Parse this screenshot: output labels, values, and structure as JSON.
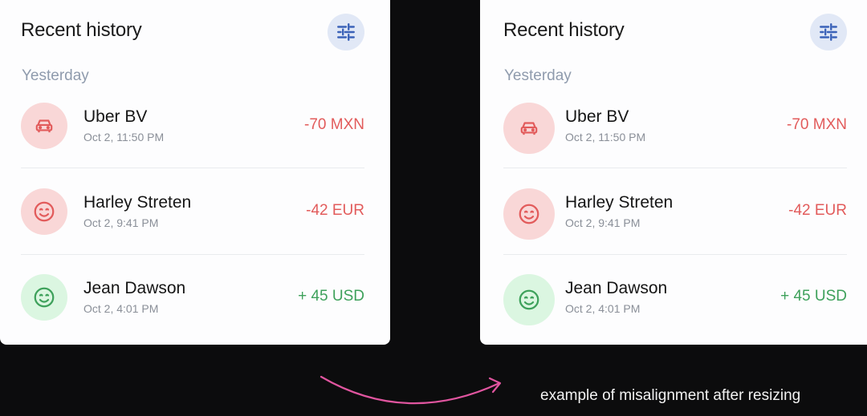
{
  "panels": [
    {
      "title": "Recent history",
      "section_label": "Yesterday",
      "transactions": [
        {
          "name": "Uber BV",
          "time": "Oct 2, 11:50 PM",
          "amount": "-70 MXN",
          "icon": "car-icon",
          "tone": "negative"
        },
        {
          "name": "Harley Streten",
          "time": "Oct 2, 9:41 PM",
          "amount": "-42 EUR",
          "icon": "smile-icon",
          "tone": "negative"
        },
        {
          "name": "Jean Dawson",
          "time": "Oct 2, 4:01 PM",
          "amount": "+ 45 USD",
          "icon": "smile-icon",
          "tone": "positive"
        }
      ]
    },
    {
      "title": "Recent history",
      "section_label": "Yesterday",
      "transactions": [
        {
          "name": "Uber BV",
          "time": "Oct 2, 11:50 PM",
          "amount": "-70 MXN",
          "icon": "car-icon",
          "tone": "negative"
        },
        {
          "name": "Harley Streten",
          "time": "Oct 2, 9:41 PM",
          "amount": "-42 EUR",
          "icon": "smile-icon",
          "tone": "negative"
        },
        {
          "name": "Jean Dawson",
          "time": "Oct 2, 4:01 PM",
          "amount": "+ 45 USD",
          "icon": "smile-icon",
          "tone": "positive"
        }
      ]
    }
  ],
  "caption": "example of misalignment after resizing",
  "colors": {
    "negative": "#e25b5b",
    "positive": "#3ea15b",
    "filter_accent": "#3b62b8",
    "arrow": "#e0559f"
  }
}
